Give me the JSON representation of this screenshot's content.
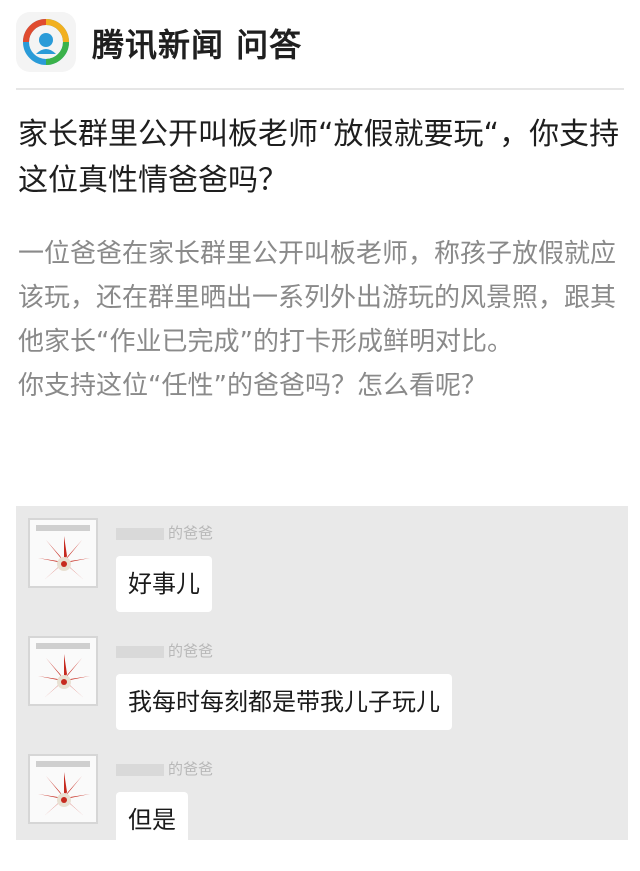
{
  "header": {
    "brand": "腾讯新闻 问答",
    "logo_icon": "tencent-news-logo"
  },
  "question": {
    "title": "家长群里公开叫板老师“放假就要玩“，你支持这位真性情爸爸吗？"
  },
  "description": {
    "lines": [
      "一位爸爸在家长群里公开叫板老师，称孩子放假就应该玩，还在群里晒出一系列外出游玩的风景照，跟其他家长“作业已完成”的打卡形成鲜明对比。",
      "你支持这位“任性”的爸爸吗？怎么看呢？"
    ]
  },
  "chat": {
    "messages": [
      {
        "sender": "的爸爸",
        "text": "好事儿"
      },
      {
        "sender": "的爸爸",
        "text": "我每时每刻都是带我儿子玩儿"
      },
      {
        "sender": "的爸爸",
        "text": "但是"
      }
    ]
  },
  "colors": {
    "text_dark": "#1e1e1e",
    "text_grey": "#8a8a8a",
    "chat_bg": "#e9e9e9",
    "avatar_red": "#c62a1f"
  }
}
